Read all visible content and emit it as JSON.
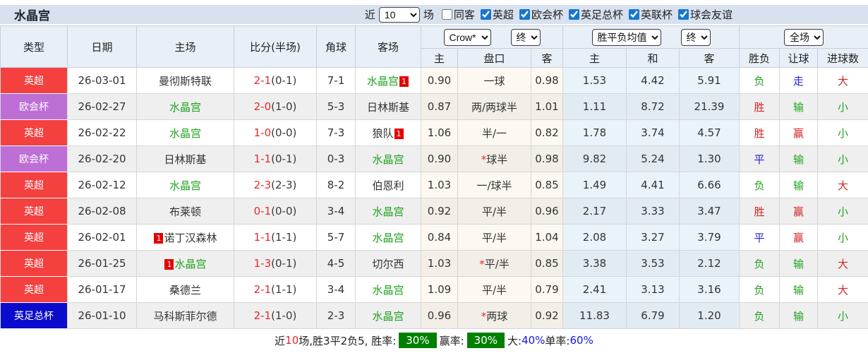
{
  "palette": {
    "league_colors": {
      "英超": "#f4403f",
      "欧会杯": "#bd6fd6",
      "英足总杯": "#0b0bcd"
    },
    "result_colors": {
      "r": "#d42525",
      "g": "#1fa31f",
      "b": "#2323cf"
    },
    "subject_team_color": "#1fa31f",
    "badge_green": "#008000"
  },
  "toolbar": {
    "title": "水晶宫",
    "near_label": "近",
    "matches_value": "10",
    "matches_label": "场",
    "checkboxes": [
      {
        "label": "同客",
        "checked": false
      },
      {
        "label": "英超",
        "checked": true
      },
      {
        "label": "欧会杯",
        "checked": true
      },
      {
        "label": "英足总杯",
        "checked": true
      },
      {
        "label": "英联杯",
        "checked": true
      },
      {
        "label": "球会友谊",
        "checked": true
      }
    ]
  },
  "table": {
    "columns": {
      "type": "类型",
      "date": "日期",
      "home": "主场",
      "score": "比分(半场)",
      "corner": "角球",
      "away": "客场",
      "odds_cols": [
        "主",
        "盘口",
        "客"
      ],
      "avg_cols": [
        "主",
        "和",
        "客"
      ],
      "result_cols": [
        "胜负",
        "让球",
        "进球数"
      ]
    },
    "selects": {
      "bookmaker": "Crow*",
      "bookmaker_period": "终",
      "avg": "胜平负均值",
      "avg_period": "终",
      "scope": "全场"
    },
    "rows": [
      {
        "league": "英超",
        "date": "26-03-01",
        "home": {
          "name": "曼彻斯特联"
        },
        "score": "2-1",
        "half": "(0-1)",
        "corner": "7-1",
        "away": {
          "name": "水晶宫",
          "subject": true,
          "card": "1",
          "card_pos": "after"
        },
        "odds": [
          "0.90",
          "一球",
          "0.98"
        ],
        "avg": [
          "1.53",
          "4.42",
          "5.91"
        ],
        "results": [
          [
            "负",
            "g"
          ],
          [
            "走",
            "b"
          ],
          [
            "大",
            "r"
          ]
        ]
      },
      {
        "league": "欧会杯",
        "date": "26-02-27",
        "home": {
          "name": "水晶宫",
          "subject": true
        },
        "score": "2-0",
        "half": "(1-0)",
        "corner": "5-3",
        "away": {
          "name": "日林斯基"
        },
        "odds": [
          "0.87",
          "两/两球半",
          "1.01"
        ],
        "avg": [
          "1.11",
          "8.72",
          "21.39"
        ],
        "results": [
          [
            "胜",
            "r"
          ],
          [
            "输",
            "g"
          ],
          [
            "小",
            "g"
          ]
        ]
      },
      {
        "league": "英超",
        "date": "26-02-22",
        "home": {
          "name": "水晶宫",
          "subject": true
        },
        "score": "1-0",
        "half": "(0-0)",
        "corner": "7-3",
        "away": {
          "name": "狼队",
          "card": "1",
          "card_pos": "after"
        },
        "odds": [
          "1.06",
          "半/一",
          "0.82"
        ],
        "avg": [
          "1.78",
          "3.74",
          "4.57"
        ],
        "results": [
          [
            "胜",
            "r"
          ],
          [
            "赢",
            "r"
          ],
          [
            "小",
            "g"
          ]
        ]
      },
      {
        "league": "欧会杯",
        "date": "26-02-20",
        "home": {
          "name": "日林斯基"
        },
        "score": "1-1",
        "half": "(0-1)",
        "corner": "0-3",
        "away": {
          "name": "水晶宫",
          "subject": true
        },
        "odds": [
          "0.90",
          "*球半",
          "0.98"
        ],
        "avg": [
          "9.82",
          "5.24",
          "1.30"
        ],
        "results": [
          [
            "平",
            "b"
          ],
          [
            "输",
            "g"
          ],
          [
            "小",
            "g"
          ]
        ]
      },
      {
        "league": "英超",
        "date": "26-02-12",
        "home": {
          "name": "水晶宫",
          "subject": true
        },
        "score": "2-3",
        "half": "(2-3)",
        "corner": "8-2",
        "away": {
          "name": "伯恩利"
        },
        "odds": [
          "1.03",
          "一/球半",
          "0.85"
        ],
        "avg": [
          "1.49",
          "4.41",
          "6.66"
        ],
        "results": [
          [
            "负",
            "g"
          ],
          [
            "输",
            "g"
          ],
          [
            "大",
            "r"
          ]
        ]
      },
      {
        "league": "英超",
        "date": "26-02-08",
        "home": {
          "name": "布莱顿"
        },
        "score": "0-1",
        "half": "(0-0)",
        "corner": "3-4",
        "away": {
          "name": "水晶宫",
          "subject": true
        },
        "odds": [
          "0.92",
          "平/半",
          "0.96"
        ],
        "avg": [
          "2.17",
          "3.33",
          "3.47"
        ],
        "results": [
          [
            "胜",
            "r"
          ],
          [
            "赢",
            "r"
          ],
          [
            "小",
            "g"
          ]
        ]
      },
      {
        "league": "英超",
        "date": "26-02-01",
        "home": {
          "name": "诺丁汉森林",
          "card": "1",
          "card_pos": "before"
        },
        "score": "1-1",
        "half": "(1-1)",
        "corner": "5-7",
        "away": {
          "name": "水晶宫",
          "subject": true
        },
        "odds": [
          "0.84",
          "平/半",
          "1.04"
        ],
        "avg": [
          "2.08",
          "3.27",
          "3.79"
        ],
        "results": [
          [
            "平",
            "b"
          ],
          [
            "赢",
            "r"
          ],
          [
            "小",
            "g"
          ]
        ]
      },
      {
        "league": "英超",
        "date": "26-01-25",
        "home": {
          "name": "水晶宫",
          "subject": true,
          "card": "1",
          "card_pos": "before"
        },
        "score": "1-3",
        "half": "(0-1)",
        "corner": "4-5",
        "away": {
          "name": "切尔西"
        },
        "odds": [
          "1.03",
          "*平/半",
          "0.85"
        ],
        "avg": [
          "3.38",
          "3.53",
          "2.12"
        ],
        "results": [
          [
            "负",
            "g"
          ],
          [
            "输",
            "g"
          ],
          [
            "大",
            "r"
          ]
        ]
      },
      {
        "league": "英超",
        "date": "26-01-17",
        "home": {
          "name": "桑德兰"
        },
        "score": "2-1",
        "half": "(1-1)",
        "corner": "3-4",
        "away": {
          "name": "水晶宫",
          "subject": true
        },
        "odds": [
          "1.09",
          "平/半",
          "0.79"
        ],
        "avg": [
          "2.41",
          "3.13",
          "3.16"
        ],
        "results": [
          [
            "负",
            "g"
          ],
          [
            "输",
            "g"
          ],
          [
            "大",
            "r"
          ]
        ]
      },
      {
        "league": "英足总杯",
        "date": "26-01-10",
        "home": {
          "name": "马科斯菲尔德"
        },
        "score": "2-1",
        "half": "(1-0)",
        "corner": "2-3",
        "away": {
          "name": "水晶宫",
          "subject": true
        },
        "odds": [
          "0.96",
          "*两球",
          "0.92"
        ],
        "avg": [
          "11.83",
          "6.79",
          "1.20"
        ],
        "results": [
          [
            "负",
            "g"
          ],
          [
            "输",
            "g"
          ],
          [
            "小",
            "g"
          ]
        ]
      }
    ]
  },
  "footer": {
    "segments": [
      {
        "text": "近",
        "style": "normal"
      },
      {
        "text": "10",
        "style": "red"
      },
      {
        "text": "场,胜3平2负5, 胜率:",
        "style": "normal"
      },
      {
        "text": "30%",
        "style": "badge"
      },
      {
        "text": " 赢率:",
        "style": "normal"
      },
      {
        "text": "30%",
        "style": "badge"
      },
      {
        "text": " 大:",
        "style": "normal"
      },
      {
        "text": "40%",
        "style": "blue"
      },
      {
        "text": " 单率:",
        "style": "normal"
      },
      {
        "text": "60%",
        "style": "blue"
      }
    ]
  }
}
